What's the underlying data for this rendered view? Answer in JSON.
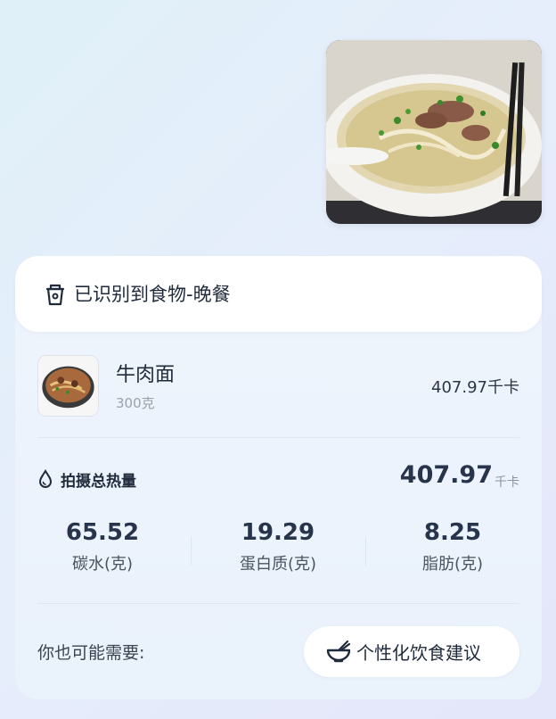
{
  "header": {
    "text": "已识别到食物-晚餐"
  },
  "food_items": [
    {
      "name": "牛肉面",
      "weight": "300克",
      "calories": "407.97千卡"
    }
  ],
  "total": {
    "label": "拍摄总热量",
    "value": "407.97",
    "unit": "千卡"
  },
  "macros": [
    {
      "value": "65.52",
      "label": "碳水(克)"
    },
    {
      "value": "19.29",
      "label": "蛋白质(克)"
    },
    {
      "value": "8.25",
      "label": "脂肪(克)"
    }
  ],
  "suggestion": {
    "label": "你也可能需要:",
    "button_label": "个性化饮食建议"
  }
}
